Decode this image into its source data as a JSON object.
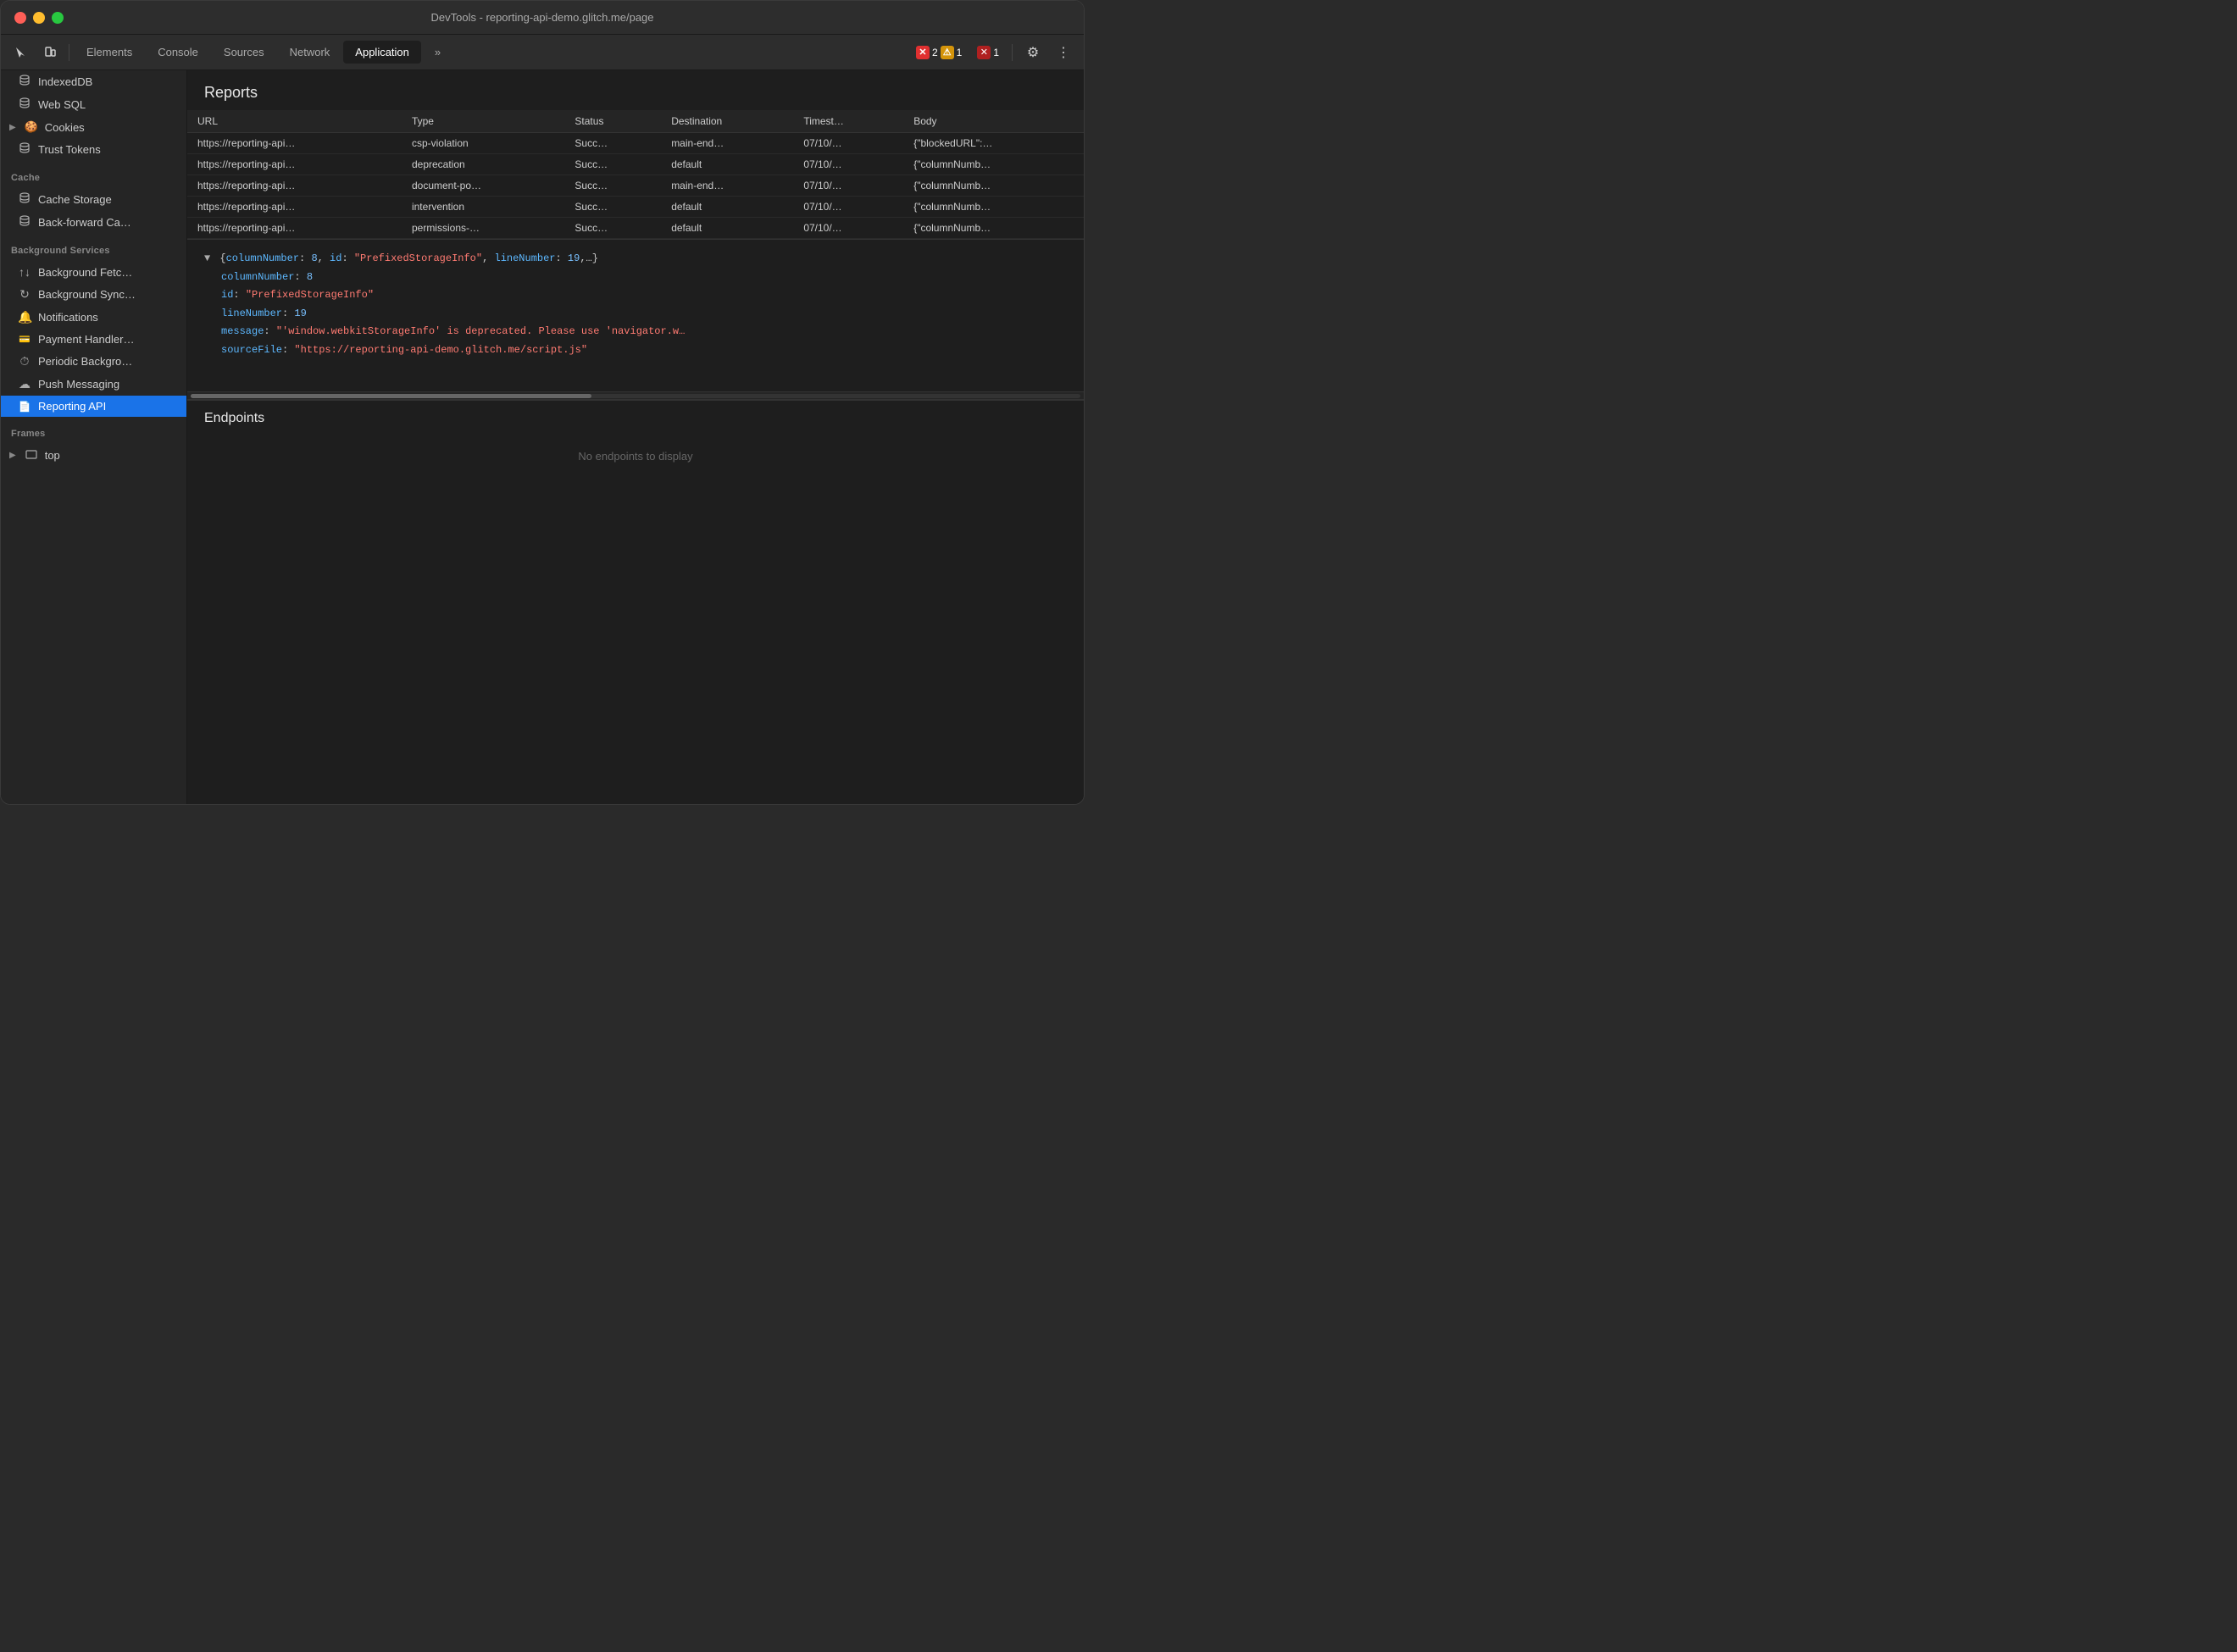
{
  "titlebar": {
    "title": "DevTools - reporting-api-demo.glitch.me/page"
  },
  "toolbar": {
    "tabs": [
      {
        "id": "elements",
        "label": "Elements",
        "active": false
      },
      {
        "id": "console",
        "label": "Console",
        "active": false
      },
      {
        "id": "sources",
        "label": "Sources",
        "active": false
      },
      {
        "id": "network",
        "label": "Network",
        "active": false
      },
      {
        "id": "application",
        "label": "Application",
        "active": true
      }
    ],
    "error_count": "2",
    "warn_count": "1",
    "x_count": "1",
    "more_tabs": "»"
  },
  "sidebar": {
    "items": [
      {
        "id": "indexed-db",
        "label": "IndexedDB",
        "icon": "🗃",
        "indent": false
      },
      {
        "id": "web-sql",
        "label": "Web SQL",
        "icon": "🗃",
        "indent": false
      },
      {
        "id": "cookies",
        "label": "Cookies",
        "icon": "🍪",
        "indent": false,
        "has_arrow": true
      },
      {
        "id": "trust-tokens",
        "label": "Trust Tokens",
        "icon": "🗃",
        "indent": false
      }
    ],
    "cache_section": "Cache",
    "cache_items": [
      {
        "id": "cache-storage",
        "label": "Cache Storage",
        "icon": "🗃"
      },
      {
        "id": "back-forward",
        "label": "Back-forward Ca…",
        "icon": "🗃"
      }
    ],
    "bg_section": "Background Services",
    "bg_items": [
      {
        "id": "bg-fetch",
        "label": "Background Fetc…",
        "icon": "↑↓"
      },
      {
        "id": "bg-sync",
        "label": "Background Sync…",
        "icon": "↻"
      },
      {
        "id": "notifications",
        "label": "Notifications",
        "icon": "🔔"
      },
      {
        "id": "payment-handler",
        "label": "Payment Handler…",
        "icon": "💳"
      },
      {
        "id": "periodic-bg",
        "label": "Periodic Backgro…",
        "icon": "⏱"
      },
      {
        "id": "push-messaging",
        "label": "Push Messaging",
        "icon": "☁"
      },
      {
        "id": "reporting-api",
        "label": "Reporting API",
        "icon": "📄",
        "active": true
      }
    ],
    "frames_section": "Frames",
    "frames_items": [
      {
        "id": "frames-top",
        "label": "top",
        "icon": "▭",
        "has_arrow": true
      }
    ]
  },
  "content": {
    "reports_title": "Reports",
    "table": {
      "headers": [
        "URL",
        "Type",
        "Status",
        "Destination",
        "Timest…",
        "Body"
      ],
      "rows": [
        {
          "url": "https://reporting-api…",
          "type": "csp-violation",
          "status": "Succ…",
          "destination": "main-end…",
          "timestamp": "07/10/…",
          "body": "{\"blockedURL\":…"
        },
        {
          "url": "https://reporting-api…",
          "type": "deprecation",
          "status": "Succ…",
          "destination": "default",
          "timestamp": "07/10/…",
          "body": "{\"columnNumb…"
        },
        {
          "url": "https://reporting-api…",
          "type": "document-po…",
          "status": "Succ…",
          "destination": "main-end…",
          "timestamp": "07/10/…",
          "body": "{\"columnNumb…"
        },
        {
          "url": "https://reporting-api…",
          "type": "intervention",
          "status": "Succ…",
          "destination": "default",
          "timestamp": "07/10/…",
          "body": "{\"columnNumb…"
        },
        {
          "url": "https://reporting-api…",
          "type": "permissions-…",
          "status": "Succ…",
          "destination": "default",
          "timestamp": "07/10/…",
          "body": "{\"columnNumb…"
        }
      ]
    },
    "json_summary": "{columnNumber: 8, id: \"PrefixedStorageInfo\", lineNumber: 19,…}",
    "json_fields": [
      {
        "key": "columnNumber",
        "value": "8",
        "type": "num"
      },
      {
        "key": "id",
        "value": "\"PrefixedStorageInfo\"",
        "type": "str"
      },
      {
        "key": "lineNumber",
        "value": "19",
        "type": "num"
      },
      {
        "key": "message",
        "value": "\"'window.webkitStorageInfo' is deprecated. Please use 'navigator.w…",
        "type": "str"
      },
      {
        "key": "sourceFile",
        "value": "\"https://reporting-api-demo.glitch.me/script.js\"",
        "type": "str"
      }
    ],
    "endpoints_title": "Endpoints",
    "endpoints_empty": "No endpoints to display"
  }
}
